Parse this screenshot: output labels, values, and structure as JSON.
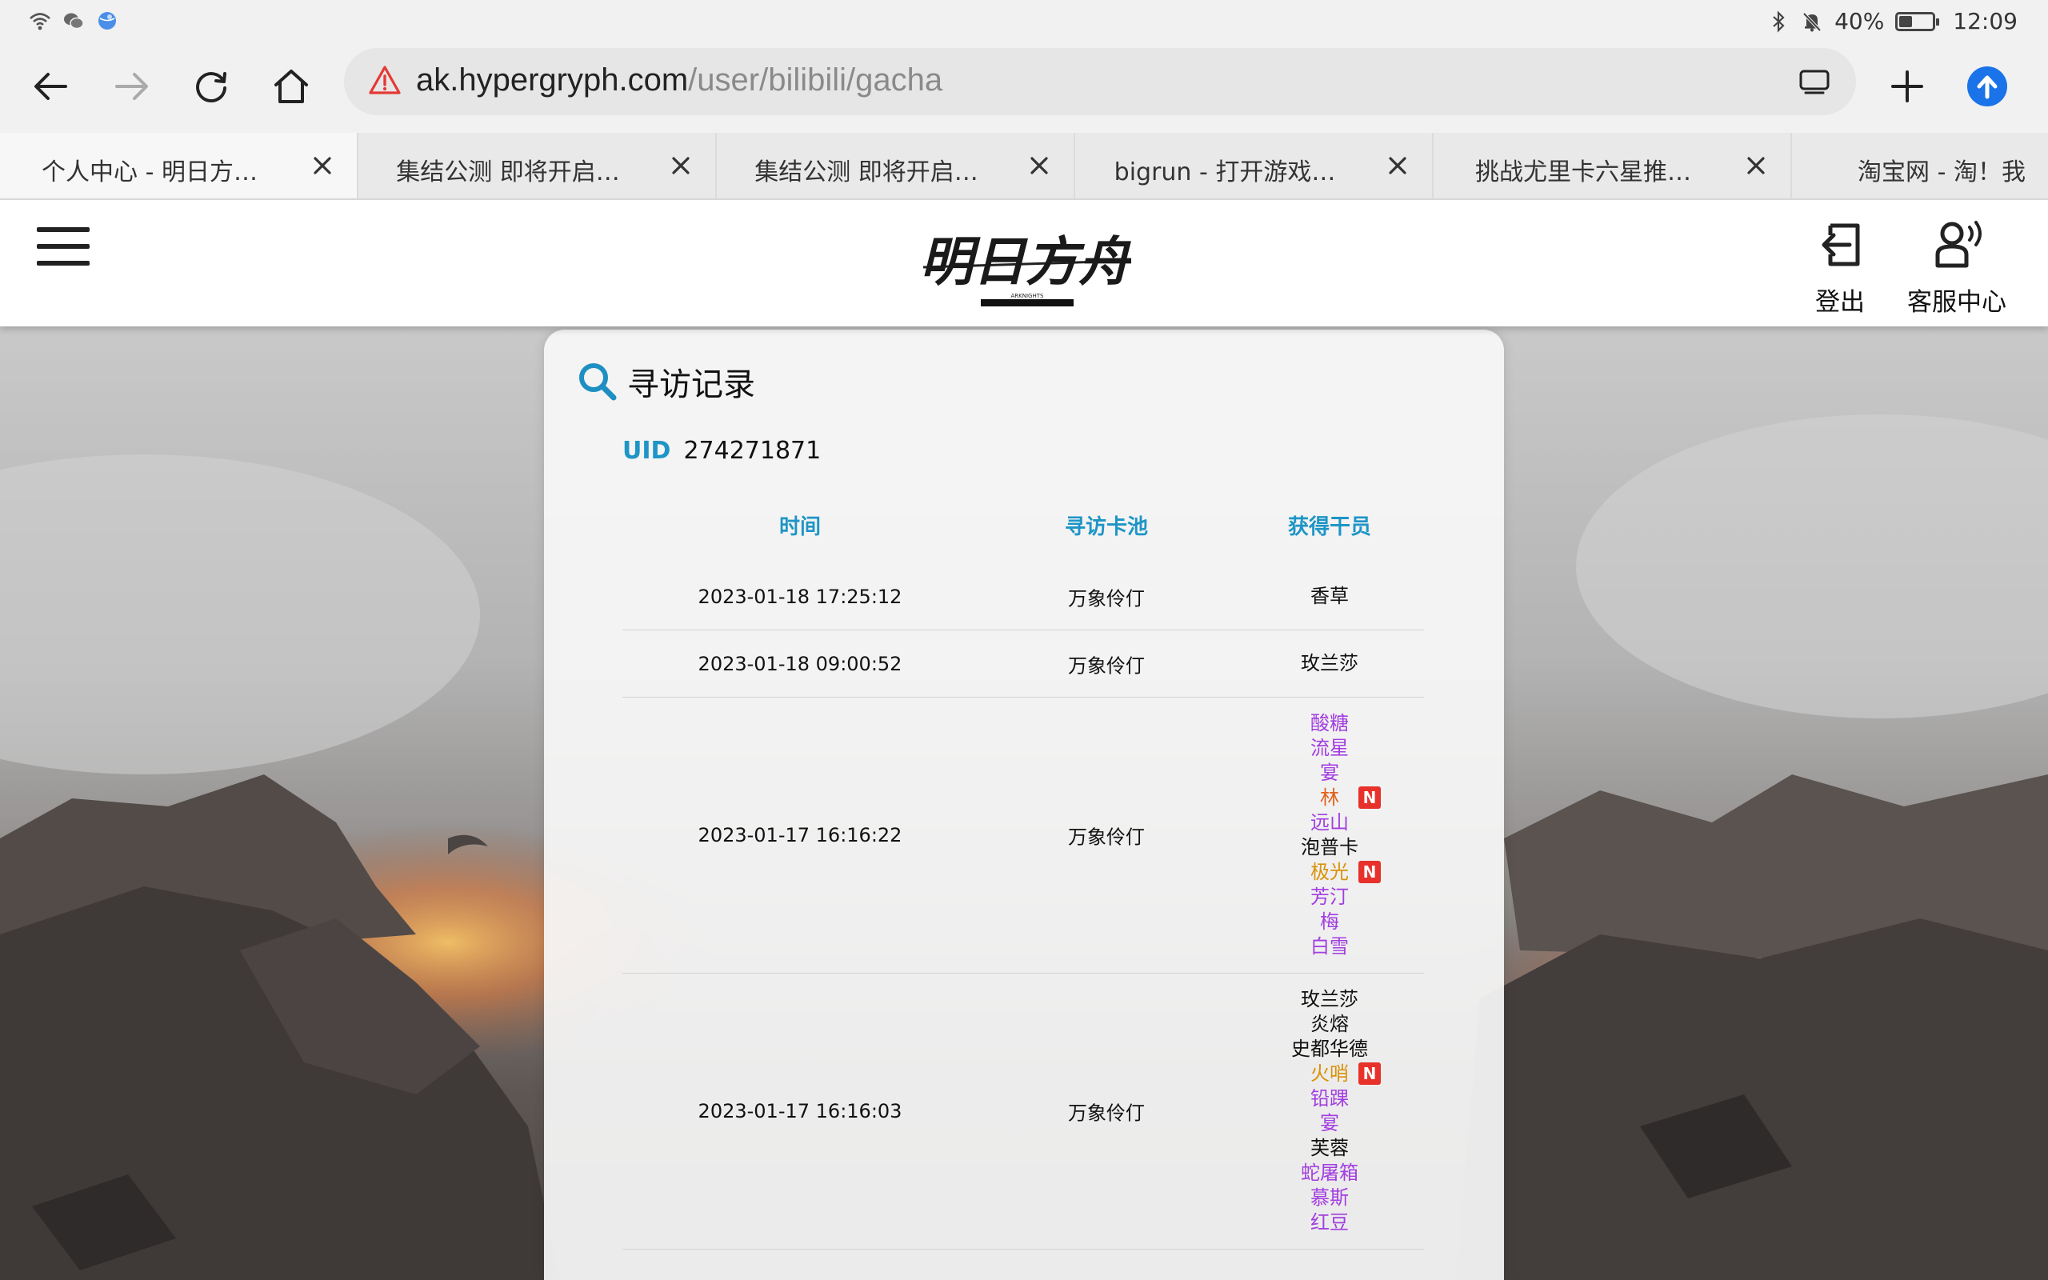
{
  "status_bar": {
    "battery_text": "40%",
    "battery_level": 0.4,
    "time": "12:09",
    "left_icons": [
      "wifi-icon",
      "wechat-icon",
      "browser-globe-icon"
    ],
    "right_icons": [
      "bluetooth-icon",
      "mute-bell-icon"
    ]
  },
  "toolbar": {
    "url_host": "ak.hypergryph.com",
    "url_path": "/user/bilibili/gacha",
    "icons": [
      "back-arrow-icon",
      "forward-arrow-icon",
      "reload-icon",
      "home-icon",
      "insecure-warning-icon",
      "tab-manager-icon",
      "new-tab-plus-icon",
      "upload-circle-icon"
    ]
  },
  "tabs": [
    {
      "title": "个人中心 - 明日方…",
      "active": true
    },
    {
      "title": "集结公测 即将开启…",
      "active": false
    },
    {
      "title": "集结公测 即将开启…",
      "active": false
    },
    {
      "title": "bigrun - 打开游戏…",
      "active": false
    },
    {
      "title": "挑战尤里卡六星推…",
      "active": false
    },
    {
      "title": "淘宝网 - 淘！我",
      "active": false
    }
  ],
  "site_header": {
    "logout_label": "登出",
    "support_label": "客服中心",
    "logo_text": "明日方舟",
    "logo_subtext": "ARKNIGHTS"
  },
  "card": {
    "title": "寻访记录",
    "uid_label": "UID",
    "uid_value": "274271871",
    "columns": [
      "时间",
      "寻访卡池",
      "获得干员"
    ],
    "rarity_colors": {
      "3": "#111111",
      "4": "#a23ee0",
      "5": "#d9920a",
      "6": "#e0621a"
    },
    "new_badge_text": "N",
    "records": [
      {
        "time": "2023-01-18 17:25:12",
        "pool": "万象伶仃",
        "operators": [
          {
            "name": "香草",
            "rarity": 3,
            "new": false
          }
        ]
      },
      {
        "time": "2023-01-18 09:00:52",
        "pool": "万象伶仃",
        "operators": [
          {
            "name": "玫兰莎",
            "rarity": 3,
            "new": false
          }
        ]
      },
      {
        "time": "2023-01-17 16:16:22",
        "pool": "万象伶仃",
        "operators": [
          {
            "name": "酸糖",
            "rarity": 4,
            "new": false
          },
          {
            "name": "流星",
            "rarity": 4,
            "new": false
          },
          {
            "name": "宴",
            "rarity": 4,
            "new": false
          },
          {
            "name": "林",
            "rarity": 6,
            "new": true
          },
          {
            "name": "远山",
            "rarity": 4,
            "new": false
          },
          {
            "name": "泡普卡",
            "rarity": 3,
            "new": false
          },
          {
            "name": "极光",
            "rarity": 5,
            "new": true
          },
          {
            "name": "芳汀",
            "rarity": 4,
            "new": false
          },
          {
            "name": "梅",
            "rarity": 4,
            "new": false
          },
          {
            "name": "白雪",
            "rarity": 4,
            "new": false
          }
        ]
      },
      {
        "time": "2023-01-17 16:16:03",
        "pool": "万象伶仃",
        "operators": [
          {
            "name": "玫兰莎",
            "rarity": 3,
            "new": false
          },
          {
            "name": "炎熔",
            "rarity": 3,
            "new": false
          },
          {
            "name": "史都华德",
            "rarity": 3,
            "new": false
          },
          {
            "name": "火哨",
            "rarity": 5,
            "new": true
          },
          {
            "name": "铅踝",
            "rarity": 4,
            "new": false
          },
          {
            "name": "宴",
            "rarity": 4,
            "new": false
          },
          {
            "name": "芙蓉",
            "rarity": 3,
            "new": false
          },
          {
            "name": "蛇屠箱",
            "rarity": 4,
            "new": false
          },
          {
            "name": "慕斯",
            "rarity": 4,
            "new": false
          },
          {
            "name": "红豆",
            "rarity": 4,
            "new": false
          }
        ]
      }
    ]
  }
}
